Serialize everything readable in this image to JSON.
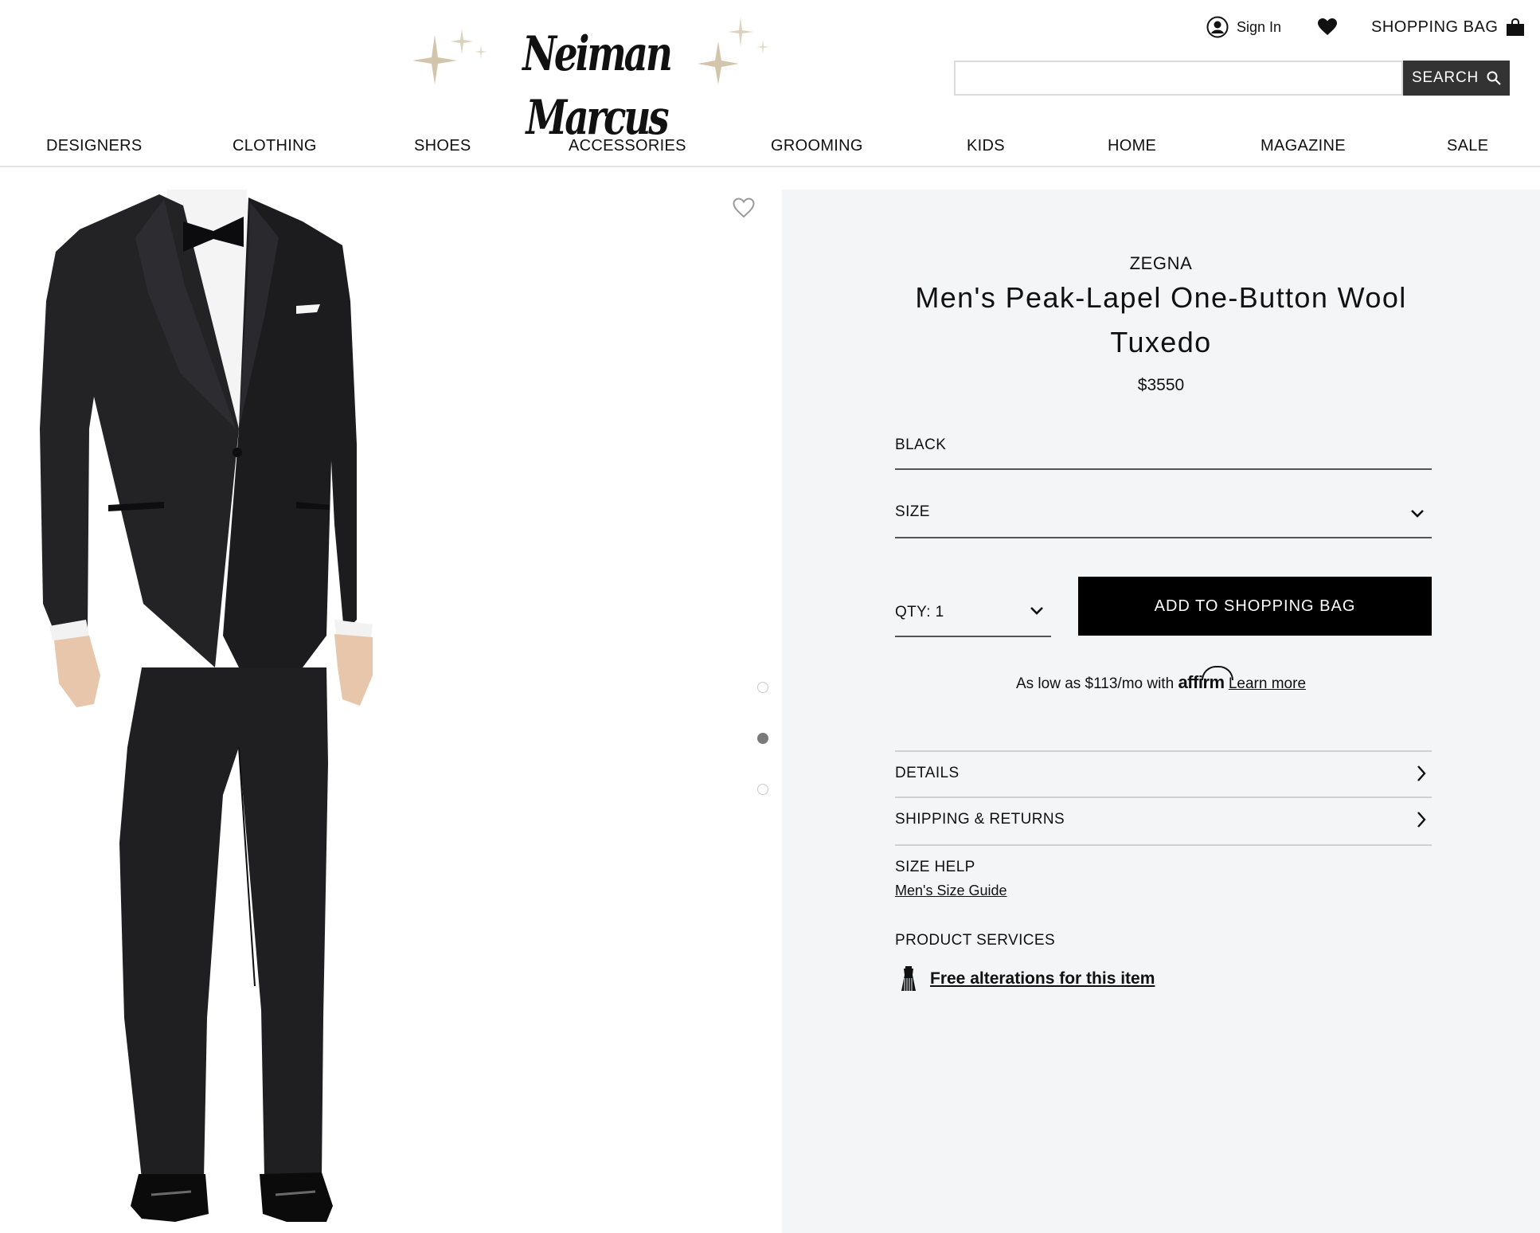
{
  "header": {
    "logo_text": "Neiman Marcus",
    "sign_in": "Sign In",
    "shopping_bag": "SHOPPING BAG",
    "search_placeholder": "",
    "search_button": "SEARCH"
  },
  "nav": {
    "items": [
      "DESIGNERS",
      "CLOTHING",
      "SHOES",
      "ACCESSORIES",
      "GROOMING",
      "KIDS",
      "HOME",
      "MAGAZINE",
      "SALE"
    ]
  },
  "gallery": {
    "image_count": 3,
    "active_index": 1
  },
  "product": {
    "brand": "ZEGNA",
    "title": "Men's Peak-Lapel One-Button Wool Tuxedo",
    "price": "$3550",
    "color": "BLACK",
    "size_label": "SIZE",
    "qty_label": "QTY: 1",
    "add_to_bag": "ADD TO SHOPPING BAG"
  },
  "affirm": {
    "prefix": "As low as $113/mo with",
    "brand": "affirm",
    "learn_more": "Learn more"
  },
  "accordions": {
    "details": "DETAILS",
    "shipping": "SHIPPING & RETURNS"
  },
  "size_help": {
    "label": "SIZE HELP",
    "guide": "Men's Size Guide"
  },
  "services": {
    "label": "PRODUCT SERVICES",
    "alterations": "Free alterations for this item"
  },
  "colors": {
    "panel_bg": "#f4f5f6",
    "button_bg": "#000000",
    "search_button_bg": "#333333",
    "accent_gold": "#c9b89a"
  }
}
